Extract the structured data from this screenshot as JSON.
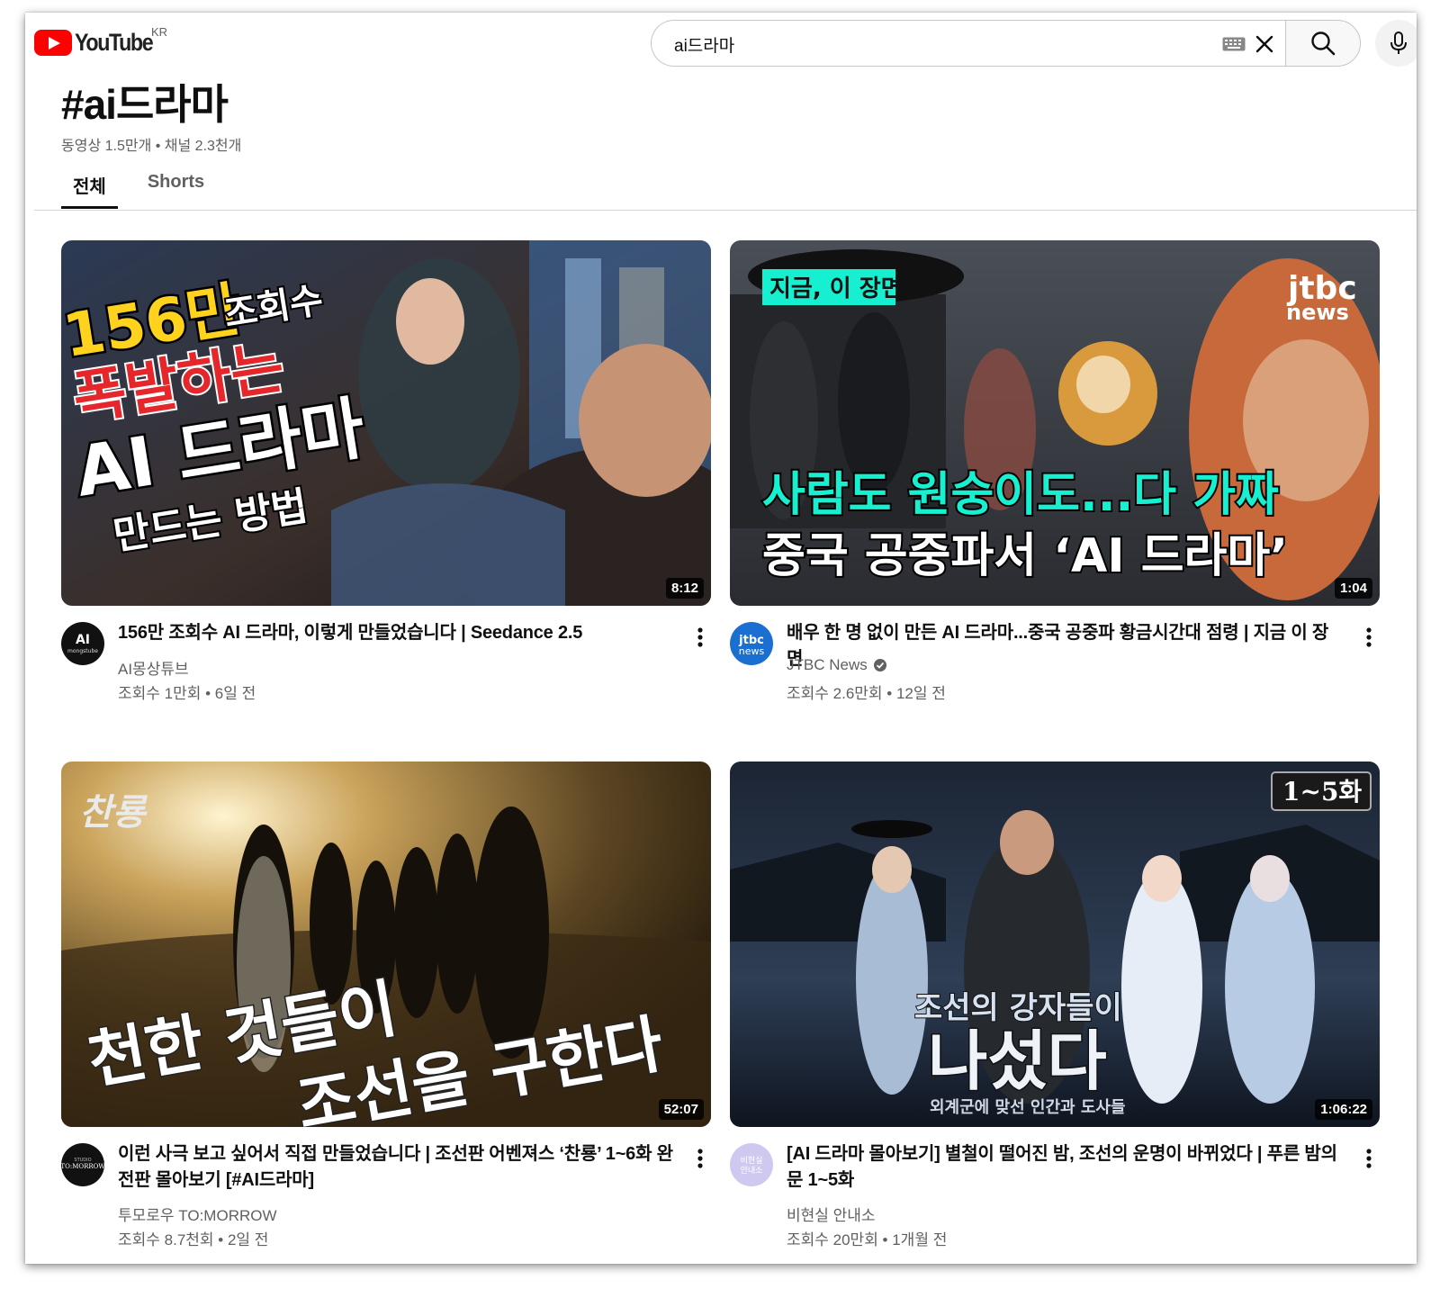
{
  "header": {
    "logo_text": "YouTube",
    "region": "KR",
    "search_value": "ai드라마"
  },
  "page": {
    "title": "#ai드라마",
    "meta": "동영상 1.5만개 • 채널 2.3천개",
    "tabs": [
      "전체",
      "Shorts"
    ],
    "active_tab": "전체"
  },
  "videos": [
    {
      "title": "156만 조회수 AI 드라마, 이렇게 만들었습니다 | Seedance 2.5",
      "channel": "AI몽상튜브",
      "stats": "조회수 1만회 • 6일 전",
      "duration": "8:12",
      "verified": false,
      "avatar_text": "AI",
      "avatar_sub": "mongstube",
      "thumb_text": [
        "156만",
        "조회수",
        "폭발하는",
        "AI 드라마",
        "만드는 방법"
      ]
    },
    {
      "title": "배우 한 명 없이 만든 AI 드라마...중국 공중파 황금시간대 점령 | 지금 이 장면",
      "channel": "JTBC News",
      "stats": "조회수 2.6만회 • 12일 전",
      "duration": "1:04",
      "verified": true,
      "avatar_text": "jtbc",
      "avatar_sub": "news",
      "thumb_text": [
        "지금, 이 장면",
        "jtbc",
        "news",
        "사람도 원숭이도...다 가짜",
        "중국 공중파서 ‘AI 드라마’"
      ]
    },
    {
      "title": "이런 사극 보고 싶어서 직접 만들었습니다 | 조선판 어벤져스 ‘찬룡’ 1~6화 완전판 몰아보기 [#AI드라마]",
      "channel": "투모로우 TO:MORROW",
      "stats": "조회수 8.7천회 • 2일 전",
      "duration": "52:07",
      "verified": false,
      "avatar_text": "TO:MORROW",
      "avatar_sub": "STUDIO",
      "thumb_text": [
        "찬룡",
        "천한 것들이",
        "조선을 구한다"
      ]
    },
    {
      "title": "[AI 드라마 몰아보기] 별철이 떨어진 밤, 조선의 운명이 바뀌었다 | 푸른 밤의 문 1~5화",
      "channel": "비현실 안내소",
      "stats": "조회수 20만회 • 1개월 전",
      "duration": "1:06:22",
      "verified": false,
      "avatar_text": "비현실",
      "avatar_sub": "안내소",
      "thumb_text": [
        "1~5화",
        "조선의 강자들이",
        "나섰다",
        "외계군에 맞선 인간과 도사들"
      ]
    }
  ],
  "colors": {
    "brand_red": "#ff0000",
    "text_primary": "#0f0f0f",
    "text_secondary": "#606060",
    "thumb1_yellow": "#ffd21e",
    "thumb1_red": "#e5262a",
    "thumb2_cyan": "#17f0d0"
  }
}
